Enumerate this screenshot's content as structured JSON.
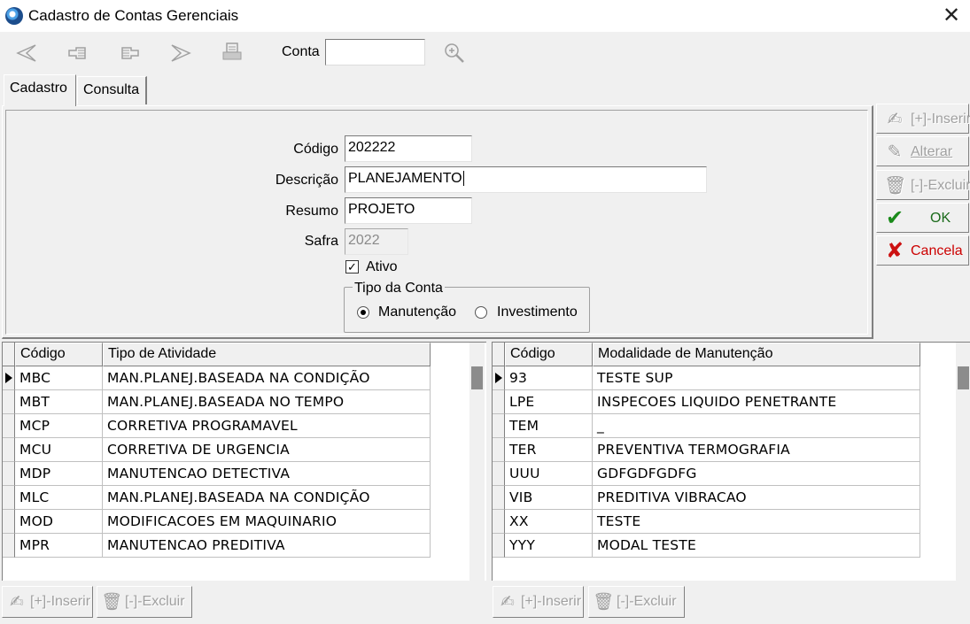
{
  "window": {
    "title": "Cadastro de Contas Gerenciais",
    "close_glyph": "✕"
  },
  "toolbar": {
    "icons": [
      "first-record-icon",
      "previous-record-icon",
      "next-record-icon",
      "last-record-icon",
      "print-icon",
      "zoom-icon"
    ],
    "conta_label": "Conta",
    "conta_value": ""
  },
  "tabs": [
    {
      "label": "Cadastro",
      "active": true
    },
    {
      "label": "Consulta",
      "active": false
    }
  ],
  "form": {
    "codigo_label": "Código",
    "codigo_value": "202222",
    "descricao_label": "Descrição",
    "descricao_value": "PLANEJAMENTO",
    "resumo_label": "Resumo",
    "resumo_value": "PROJETO",
    "safra_label": "Safra",
    "safra_value": "2022",
    "ativo_label": "Ativo",
    "ativo_checked": true,
    "tipo_legend": "Tipo da Conta",
    "tipo_options": [
      {
        "label": "Manutenção",
        "selected": true
      },
      {
        "label": "Investimento",
        "selected": false
      }
    ]
  },
  "side_buttons": {
    "inserir": "[+]-Inserir",
    "alterar": "Alterar",
    "excluir": "[-]-Excluir",
    "ok": "OK",
    "cancela": "Cancela"
  },
  "colors": {
    "ok_check": "#1a8a1a",
    "cancel_x": "#cc1111",
    "cancel_text": "#cc0000",
    "disabled_text": "#a0a0a0"
  },
  "grid_left": {
    "headers": [
      "Código",
      "Tipo de Atividade"
    ],
    "rows": [
      [
        "MBC",
        "MAN.PLANEJ.BASEADA NA CONDIÇÃO"
      ],
      [
        "MBT",
        "MAN.PLANEJ.BASEADA NO TEMPO"
      ],
      [
        "MCP",
        "CORRETIVA PROGRAMAVEL"
      ],
      [
        "MCU",
        "CORRETIVA DE URGENCIA"
      ],
      [
        "MDP",
        "MANUTENCAO DETECTIVA"
      ],
      [
        "MLC",
        "MAN.PLANEJ.BASEADA NA CONDIÇÃO"
      ],
      [
        "MOD",
        "MODIFICACOES EM MAQUINARIO"
      ],
      [
        "MPR",
        "MANUTENCAO PREDITIVA"
      ]
    ],
    "current_row": 0,
    "inserir": "[+]-Inserir",
    "excluir": "[-]-Excluir"
  },
  "grid_right": {
    "headers": [
      "Código",
      "Modalidade de Manutenção"
    ],
    "rows": [
      [
        "93",
        "TESTE SUP"
      ],
      [
        "LPE",
        "INSPECOES LIQUIDO PENETRANTE"
      ],
      [
        "TEM",
        "_"
      ],
      [
        "TER",
        "PREVENTIVA TERMOGRAFIA"
      ],
      [
        "UUU",
        "GDFGDFGDFG"
      ],
      [
        "VIB",
        "PREDITIVA VIBRACAO"
      ],
      [
        "XX",
        "TESTE"
      ],
      [
        "YYY",
        "MODAL TESTE"
      ]
    ],
    "current_row": 0,
    "inserir": "[+]-Inserir",
    "excluir": "[-]-Excluir"
  }
}
